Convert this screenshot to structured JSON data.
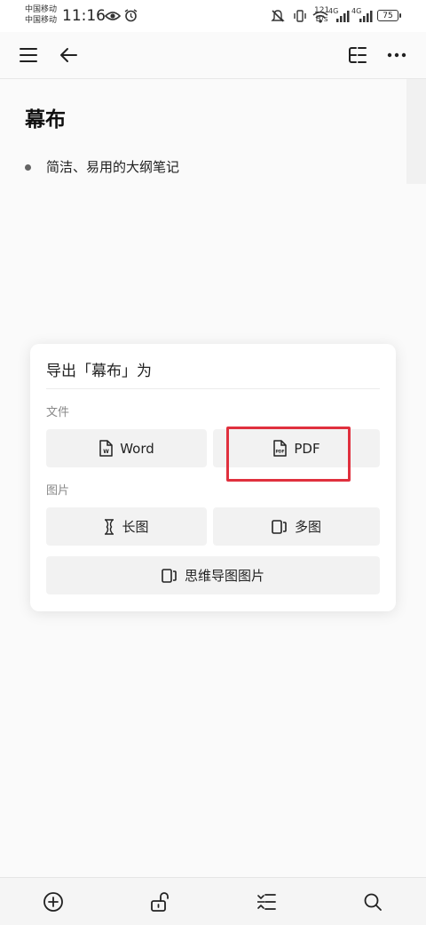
{
  "status_bar": {
    "carrier_1": "中国移动",
    "carrier_2": "中国移动",
    "time": "11:16",
    "net_speed_value": "121",
    "net_speed_unit": "B/s",
    "signal_1": "4G",
    "signal_2": "4G",
    "battery": "75"
  },
  "toolbar": {
    "menu_icon": "menu-icon",
    "back_icon": "back-arrow-icon",
    "outline_icon": "outline-icon",
    "more_icon": "more-icon"
  },
  "document": {
    "title": "幕布",
    "items": [
      "简洁、易用的大纲笔记"
    ]
  },
  "export_panel": {
    "title": "导出「幕布」为",
    "file_section": "文件",
    "image_section": "图片",
    "options": {
      "word": "Word",
      "pdf": "PDF",
      "long_image": "长图",
      "multi_image": "多图",
      "mindmap_image": "思维导图图片"
    }
  },
  "bottom_bar": {
    "icons": [
      "add-icon",
      "unlock-icon",
      "indent-icon",
      "search-icon"
    ]
  },
  "colors": {
    "highlight": "#e0303e",
    "option_bg": "#f2f2f2"
  }
}
